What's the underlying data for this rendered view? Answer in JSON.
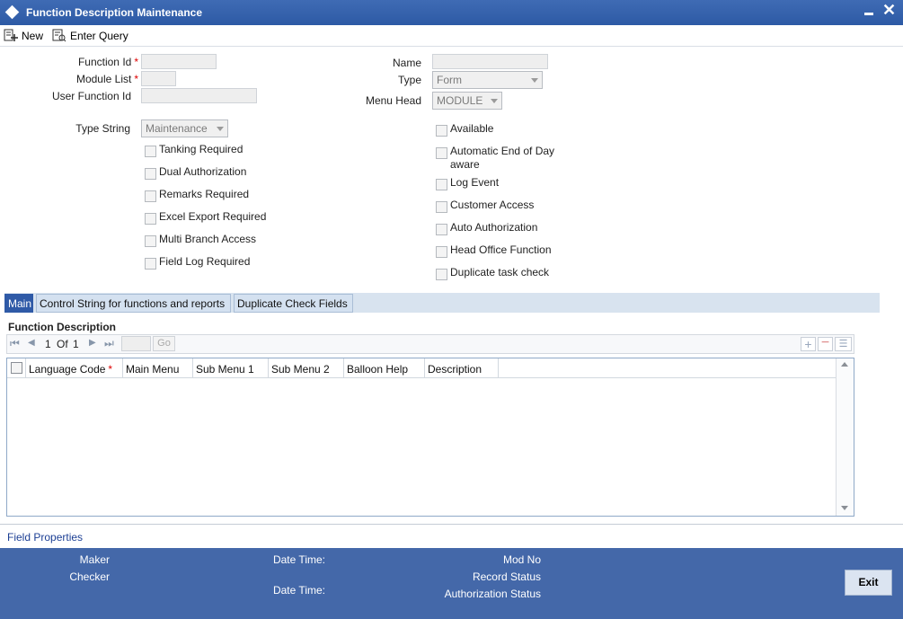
{
  "window": {
    "title": "Function Description Maintenance"
  },
  "toolbar": {
    "new_label": "New",
    "enter_query_label": "Enter Query"
  },
  "form": {
    "function_id_label": "Function Id",
    "module_list_label": "Module List",
    "user_function_id_label": "User Function Id",
    "name_label": "Name",
    "type_label": "Type",
    "type_value": "Form",
    "menu_head_label": "Menu Head",
    "menu_head_value": "MODULE",
    "type_string_label": "Type String",
    "type_string_value": "Maintenance",
    "required_marker": "*"
  },
  "checkboxes_left": [
    "Tanking Required",
    "Dual Authorization",
    "Remarks Required",
    "Excel Export Required",
    "Multi Branch Access",
    "Field Log Required"
  ],
  "checkboxes_right": [
    "Available",
    "Automatic End of Day aware",
    "Log Event",
    "Customer Access",
    "Auto Authorization",
    "Head Office Function",
    "Duplicate task check"
  ],
  "tabs": [
    {
      "label": "Main",
      "active": true
    },
    {
      "label": "Control String for functions and reports",
      "active": false
    },
    {
      "label": "Duplicate Check Fields",
      "active": false
    }
  ],
  "grid": {
    "title": "Function Description",
    "page_current": "1",
    "page_of": "Of",
    "page_total": "1",
    "go_label": "Go",
    "columns": [
      "Language Code",
      "Main Menu",
      "Sub Menu 1",
      "Sub Menu 2",
      "Balloon Help",
      "Description"
    ]
  },
  "field_properties_label": "Field Properties",
  "footer": {
    "maker_label": "Maker",
    "checker_label": "Checker",
    "date_time_label": "Date Time:",
    "mod_no_label": "Mod No",
    "record_status_label": "Record Status",
    "authorization_status_label": "Authorization Status",
    "exit_label": "Exit"
  },
  "colors": {
    "title_bar": "#2d5aa5",
    "footer": "#4468a9",
    "active_tab": "#2f5aa7",
    "required": "#dd0000"
  }
}
